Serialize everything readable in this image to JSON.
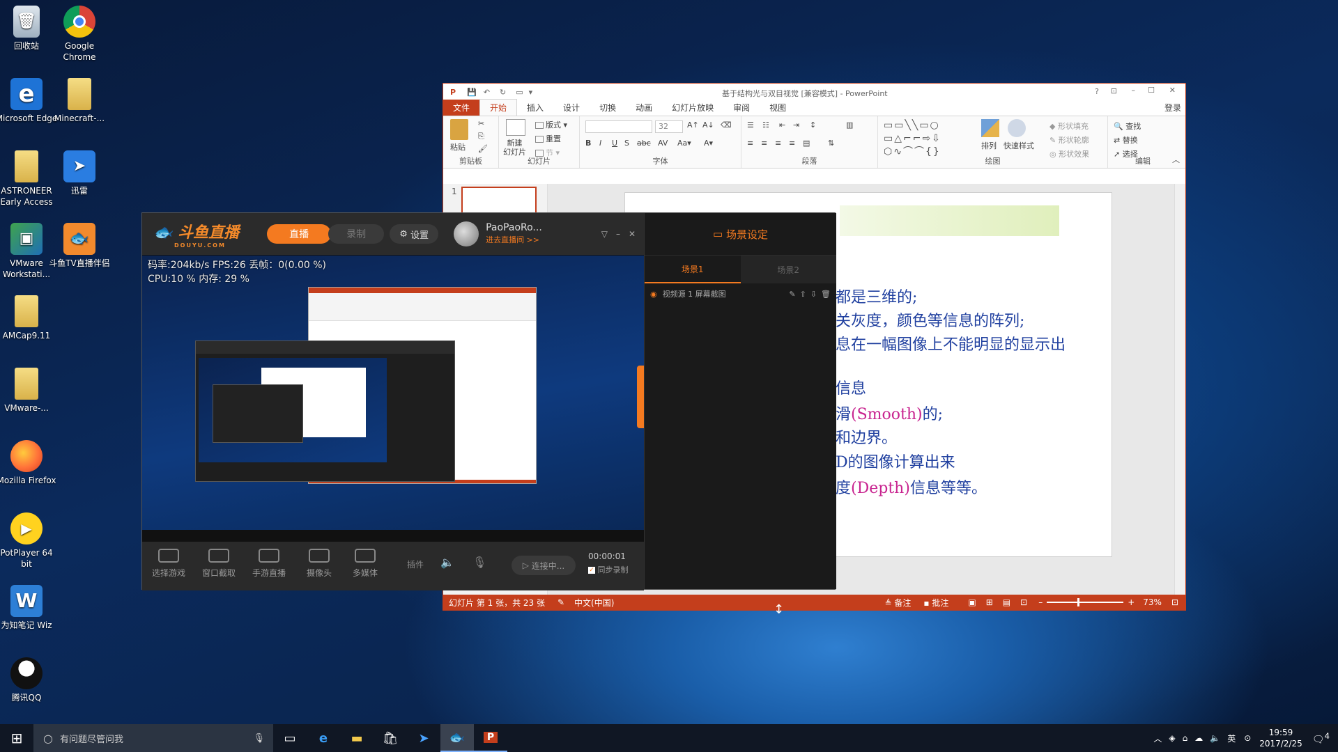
{
  "desktop": {
    "icons": [
      {
        "label": "回收站",
        "icon": "recycle-bin-icon"
      },
      {
        "label": "Google Chrome",
        "icon": "chrome-icon"
      },
      {
        "label": "Microsoft Edge",
        "icon": "edge-icon"
      },
      {
        "label": "Minecraft-...",
        "icon": "folder-icon"
      },
      {
        "label": "ASTRONEER Early Access",
        "icon": "folder-icon"
      },
      {
        "label": "迅雷",
        "icon": "thunder-icon"
      },
      {
        "label": "VMware Workstati...",
        "icon": "vmware-icon"
      },
      {
        "label": "斗鱼TV直播伴侣",
        "icon": "douyu-icon"
      },
      {
        "label": "AMCap9.11",
        "icon": "folder-icon"
      },
      {
        "label": "VMware-...",
        "icon": "folder-icon"
      },
      {
        "label": "Mozilla Firefox",
        "icon": "firefox-icon"
      },
      {
        "label": "PotPlayer 64 bit",
        "icon": "potplayer-icon"
      },
      {
        "label": "为知笔记 Wiz",
        "icon": "wiz-icon"
      },
      {
        "label": "腾讯QQ",
        "icon": "qq-icon"
      }
    ]
  },
  "ppt": {
    "title": "基于结构光与双目视觉 [兼容模式] - PowerPoint",
    "help": "?",
    "login": "登录",
    "tabs": [
      "文件",
      "开始",
      "插入",
      "设计",
      "切换",
      "动画",
      "幻灯片放映",
      "审阅",
      "视图"
    ],
    "groups": {
      "clipboard": "剪贴板",
      "slides": "幻灯片",
      "font": "字体",
      "paragraph": "段落",
      "drawing": "绘图",
      "editing": "编辑"
    },
    "tools": {
      "paste": "粘贴",
      "new_slide": "新建\n幻灯片",
      "layout": "版式",
      "reset": "重置",
      "section": "节",
      "font_size": "32",
      "arrange": "排列",
      "quick_styles": "快速样式",
      "shape_fill": "形状填充",
      "shape_outline": "形状轮廓",
      "shape_effects": "形状效果",
      "find": "查找",
      "replace": "替换",
      "select": "选择"
    },
    "thumb_number": "1",
    "slide_lines": [
      {
        "text": "都是三维的;"
      },
      {
        "text": "关灰度，颜色等信息的阵列;"
      },
      {
        "text": "息在一幅图像上不能明显的显示出"
      },
      {
        "text": "信息"
      },
      {
        "pre": "滑",
        "pink": "(Smooth)",
        "post": "的;"
      },
      {
        "text": "和边界。"
      },
      {
        "text": "D的图像计算出来"
      },
      {
        "pre": "度",
        "pink": "(Depth)",
        "post": "信息等等。"
      }
    ],
    "status": {
      "slide_info": "幻灯片 第 1 张，共 23 张",
      "language": "中文(中国)",
      "notes": "备注",
      "comments": "批注",
      "zoom": "73%"
    },
    "colors": {
      "accent": "#c43e1c",
      "slide_text": "#1f3f9f",
      "slide_pink": "#c8238f"
    }
  },
  "douyu": {
    "logo": "斗鱼直播",
    "logo_sub": "DOUYU.COM",
    "tab_live": "直播",
    "tab_record": "录制",
    "settings": "设置",
    "user": "PaoPaoRo...",
    "enter_room": "进去直播间 >>",
    "stats_line1": "码率:204kb/s  FPS:26  丢帧：0(0.00 %)",
    "stats_line2": "CPU:10 %  内存: 29 %",
    "bottom": {
      "select_game": "选择游戏",
      "window_capture": "窗口截取",
      "mobile_live": "手游直播",
      "camera": "摄像头",
      "multimedia": "多媒体",
      "plugin": "插件",
      "connecting": "连接中...",
      "timer": "00:00:01",
      "sync_record": "同步录制"
    },
    "scene_title": "场景设定",
    "scene1": "场景1",
    "scene2": "场景2",
    "source": "视频源 1 屏幕截图",
    "colors": {
      "accent": "#f48a2a"
    }
  },
  "taskbar": {
    "search_placeholder": "有问题尽管问我",
    "time": "19:59",
    "date": "2017/2/25",
    "ime": "英",
    "notifications": "4"
  }
}
